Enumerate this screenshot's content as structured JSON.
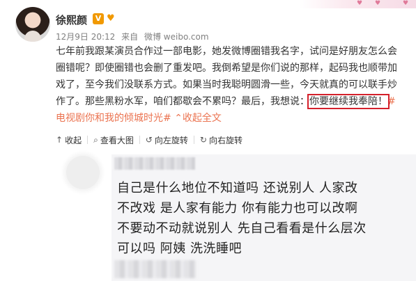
{
  "header": {
    "user_name": "徐熙颜",
    "verified_badge": "V",
    "member_icon": "vip-heart-icon"
  },
  "meta": {
    "date": "12月9日 20:12",
    "via": "来自",
    "source": "微博 weibo.com"
  },
  "post": {
    "text_before": "七年前我跟某演员合作过一部电影，她发微博圈错我名字，试问是好朋友怎么会圈错呢？即使圈错也会删了重发吧。我倒希望是你们说的那样，起码我也顺带加戏了，至今我们没联系方式。如果当时我聪明圆滑一些，今天就真的可以联手炒作了。那些黑粉水军，咱们都歇会不累吗？最后，我想说：",
    "highlight": "你要继续我奉陪！",
    "topic": "#电视剧你和我的倾城时光#",
    "collapse_label": "收起全文",
    "collapse_icon": "chevron-up-icon",
    "highlight_color": "#d4202b",
    "link_color": "#eb7350"
  },
  "toolbar": {
    "collapse": {
      "label": "收起",
      "icon": "collapse-arrow-icon"
    },
    "view_large": {
      "label": "查看大图",
      "icon": "magnifier-icon"
    },
    "rotate_left": {
      "label": "向左旋转",
      "icon": "rotate-left-icon"
    },
    "rotate_right": {
      "label": "向右旋转",
      "icon": "rotate-right-icon"
    }
  },
  "image": {
    "comment_lines": [
      "自己是什么地位不知道吗  还说别人  人家改",
      "不改戏 是人家有能力  你有能力也可以改啊",
      "不要动不动就说别人  先自己看看是什么层次",
      "可以吗  阿姨  洗洗睡吧"
    ]
  }
}
